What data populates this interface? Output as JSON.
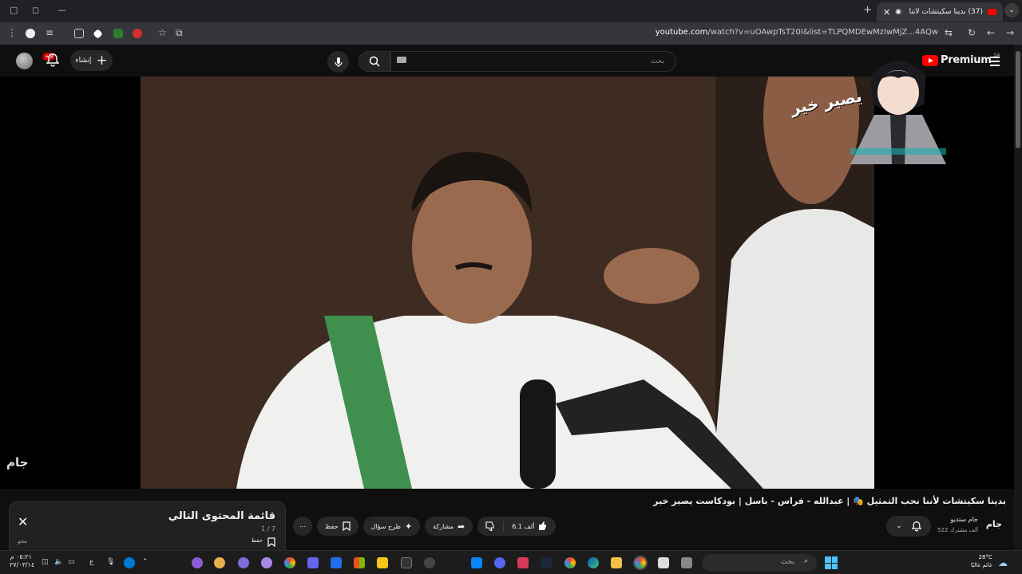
{
  "browser": {
    "tab_title": "(37) بدينا سكيتشات لأننا نحب...",
    "url_domain": "youtube.com",
    "url_path": "/watch?v=uOAwpTsT20I&list=TLPQMDEwMzIwMjZ...4AQw"
  },
  "header": {
    "search_placeholder": "بحث",
    "create_label": "إنشاء",
    "notifications_badge": "+9",
    "logo_text": "Premium",
    "logo_region": "SA"
  },
  "video": {
    "title": "بدينا سكيتشات لأننا نحب التمثيل 🎭 | عبدالله - فراس - باسل | بودكاست يصير خير",
    "watermark": "جام"
  },
  "channel": {
    "logo": "جام",
    "name": "جام ستديو",
    "subscribers": "522 ألف مشترك"
  },
  "actions": {
    "likes": "6.1 ألف",
    "share": "مشاركة",
    "ask": "طرح سؤال",
    "save": "حفظ"
  },
  "queue": {
    "title": "قائمة المحتوى التالي",
    "count": "1 / 7",
    "save": "حفظ",
    "author": "محو"
  },
  "taskbar": {
    "search_placeholder": "بحث",
    "temperature": "28°C",
    "weather": "غائم غالبًا",
    "time": "٠٥:٢١ م",
    "date": "٢٧/٠٣/١٤",
    "lang": "ع"
  },
  "colors": {
    "accent": "#ff0000",
    "bg": "#0f0f0f"
  }
}
